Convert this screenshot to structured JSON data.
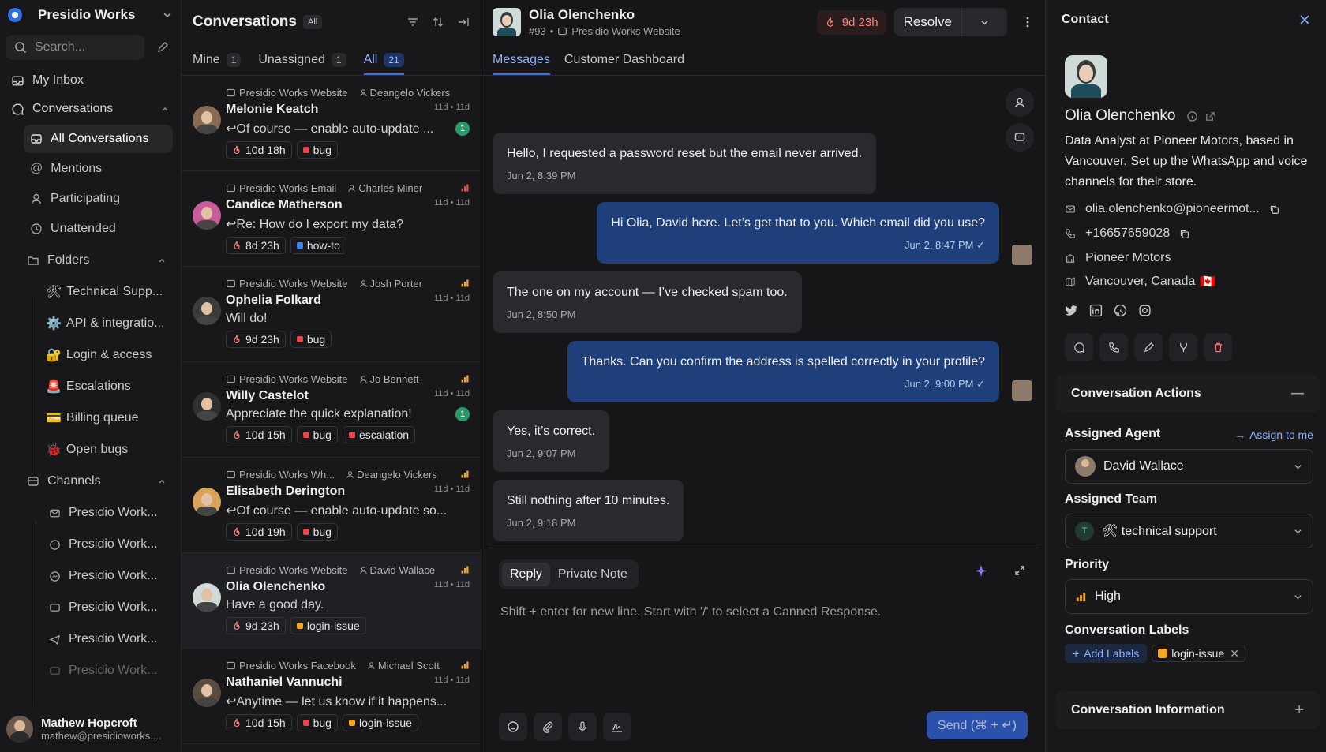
{
  "sidebar": {
    "brand": "Presidio Works",
    "search_placeholder": "Search...",
    "my_inbox": "My Inbox",
    "conversations": "Conversations",
    "subitems": [
      "All Conversations",
      "Mentions",
      "Participating",
      "Unattended"
    ],
    "folders_label": "Folders",
    "folders": [
      {
        "emoji": "🛠",
        "label": "Technical Supp..."
      },
      {
        "emoji": "⚙️",
        "label": "API & integratio..."
      },
      {
        "emoji": "🔐",
        "label": "Login & access"
      },
      {
        "emoji": "🚨",
        "label": "Escalations"
      },
      {
        "emoji": "💳",
        "label": "Billing queue"
      },
      {
        "emoji": "🐞",
        "label": "Open bugs"
      }
    ],
    "channels_label": "Channels",
    "channels": [
      "Presidio Work...",
      "Presidio Work...",
      "Presidio Work...",
      "Presidio Work...",
      "Presidio Work...",
      "Presidio Work..."
    ],
    "user": {
      "name": "Mathew Hopcroft",
      "email": "mathew@presidioworks...."
    }
  },
  "list": {
    "title": "Conversations",
    "filter_chip": "All",
    "tabs": [
      {
        "label": "Mine",
        "count": "1"
      },
      {
        "label": "Unassigned",
        "count": "1"
      },
      {
        "label": "All",
        "count": "21"
      }
    ],
    "items": [
      {
        "inbox": "Presidio Works Website",
        "agent": "Deangelo Vickers",
        "name": "Melonie Keatch",
        "time": "11d • 11d",
        "msg": "↩Of course — enable auto-update ...",
        "unread": "1",
        "sla": "10d 18h",
        "labels": [
          {
            "t": "bug",
            "c": "#e5484d"
          }
        ]
      },
      {
        "inbox": "Presidio Works Email",
        "agent": "Charles Miner",
        "name": "Candice Matherson",
        "time": "11d • 11d",
        "msg": "↩Re: How do I export my data?",
        "unread": "",
        "sla": "8d 23h",
        "labels": [
          {
            "t": "how-to",
            "c": "#3b82f6"
          }
        ]
      },
      {
        "inbox": "Presidio Works Website",
        "agent": "Josh Porter",
        "name": "Ophelia Folkard",
        "time": "11d • 11d",
        "msg": "Will do!",
        "unread": "",
        "sla": "9d 23h",
        "labels": [
          {
            "t": "bug",
            "c": "#e5484d"
          }
        ]
      },
      {
        "inbox": "Presidio Works Website",
        "agent": "Jo Bennett",
        "name": "Willy Castelot",
        "time": "11d • 11d",
        "msg": "Appreciate the quick explanation!",
        "unread": "1",
        "sla": "10d 15h",
        "labels": [
          {
            "t": "bug",
            "c": "#e5484d"
          },
          {
            "t": "escalation",
            "c": "#e5484d"
          }
        ]
      },
      {
        "inbox": "Presidio Works Wh...",
        "agent": "Deangelo Vickers",
        "name": "Elisabeth Derington",
        "time": "11d • 11d",
        "msg": "↩Of course — enable auto-update so...",
        "unread": "",
        "sla": "10d 19h",
        "labels": [
          {
            "t": "bug",
            "c": "#e5484d"
          }
        ]
      },
      {
        "inbox": "Presidio Works Website",
        "agent": "David Wallace",
        "name": "Olia Olenchenko",
        "time": "11d • 11d",
        "msg": "Have a good day.",
        "unread": "",
        "sla": "9d 23h",
        "labels": [
          {
            "t": "login-issue",
            "c": "#f5a524"
          }
        ]
      },
      {
        "inbox": "Presidio Works Facebook",
        "agent": "Michael Scott",
        "name": "Nathaniel Vannuchi",
        "time": "11d • 11d",
        "msg": "↩Anytime — let us know if it happens...",
        "unread": "",
        "sla": "10d 15h",
        "labels": [
          {
            "t": "bug",
            "c": "#e5484d"
          },
          {
            "t": "login-issue",
            "c": "#f5a524"
          }
        ]
      }
    ]
  },
  "main": {
    "contact_name": "Olia Olenchenko",
    "conv_id": "#93",
    "inbox": "Presidio Works Website",
    "sla": "9d 23h",
    "resolve": "Resolve",
    "tabs": [
      "Messages",
      "Customer Dashboard"
    ],
    "messages": [
      {
        "dir": "in",
        "text": "Hello, I requested a password reset but the email never arrived.",
        "time": "Jun 2, 8:39 PM"
      },
      {
        "dir": "out",
        "text": "Hi Olia, David here. Let’s get that to you. Which email did you use?",
        "time": "Jun 2, 8:47 PM"
      },
      {
        "dir": "in",
        "text": "The one on my account — I’ve checked spam too.",
        "time": "Jun 2, 8:50 PM"
      },
      {
        "dir": "out",
        "text": "Thanks. Can you confirm the address is spelled correctly in your profile?",
        "time": "Jun 2, 9:00 PM"
      },
      {
        "dir": "in",
        "text": "Yes, it’s correct.",
        "time": "Jun 2, 9:07 PM"
      },
      {
        "dir": "in",
        "text": "Still nothing after 10 minutes.",
        "time": "Jun 2, 9:18 PM"
      }
    ],
    "composer": {
      "reply": "Reply",
      "private_note": "Private Note",
      "placeholder": "Shift + enter for new line. Start with '/' to select a Canned Response.",
      "send": "Send (⌘ + ↵)"
    }
  },
  "contact": {
    "title": "Contact",
    "name": "Olia Olenchenko",
    "bio": "Data Analyst at Pioneer Motors, based in Vancouver. Set up the WhatsApp and voice channels for their store.",
    "email": "olia.olenchenko@pioneermot...",
    "phone": "+16657659028",
    "company": "Pioneer Motors",
    "location": "Vancouver, Canada",
    "flag": "🇨🇦",
    "conv_actions": "Conversation Actions",
    "assigned_agent_label": "Assigned Agent",
    "assign_to_me": "Assign to me",
    "assigned_agent": "David Wallace",
    "assigned_team_label": "Assigned Team",
    "team_initial": "T",
    "assigned_team": "🛠 technical support",
    "priority_label": "Priority",
    "priority": "High",
    "labels_label": "Conversation Labels",
    "add_labels": "Add Labels",
    "label": "login-issue",
    "conv_info": "Conversation Information"
  },
  "colors": {
    "accent": "#3b6ee8",
    "outgoing": "#1e3f7a",
    "sla": "#ff7d7d",
    "bug": "#e5484d",
    "login_issue": "#f5a524"
  }
}
